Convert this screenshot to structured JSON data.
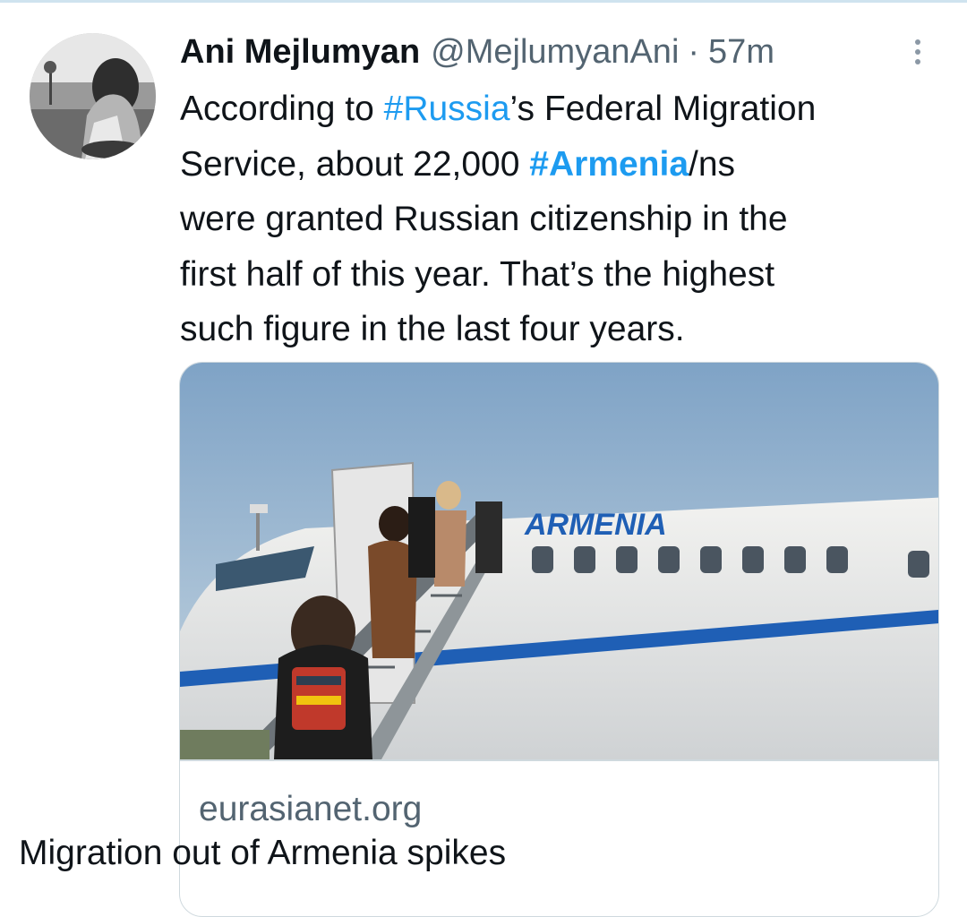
{
  "tweet": {
    "author": {
      "display_name": "Ani Mejlumyan",
      "handle": "@MejlumyanAni",
      "separator": "·",
      "time": "57m"
    },
    "text_lines": [
      [
        "According to ",
        "#Russia",
        "’s Federal Migration"
      ],
      [
        "Service, about 22,000 ",
        "#Armenia",
        "/ns"
      ],
      [
        "were granted Russian citizenship in the"
      ],
      [
        "first half of this year. That’s the highest"
      ],
      [
        "such figure in the last four years."
      ]
    ],
    "link_color": "#1d9bf0",
    "card": {
      "image_logo_text": "ARMENIA",
      "domain": "eurasianet.org",
      "title": "Migration out of Armenia spikes"
    }
  },
  "icons": {
    "more": "more-vertical-icon",
    "avatar": "profile-photo"
  },
  "colors": {
    "text": "#0f1419",
    "secondary_text": "#536471",
    "border": "#cfd9de",
    "airline_blue": "#1f5fb5"
  }
}
